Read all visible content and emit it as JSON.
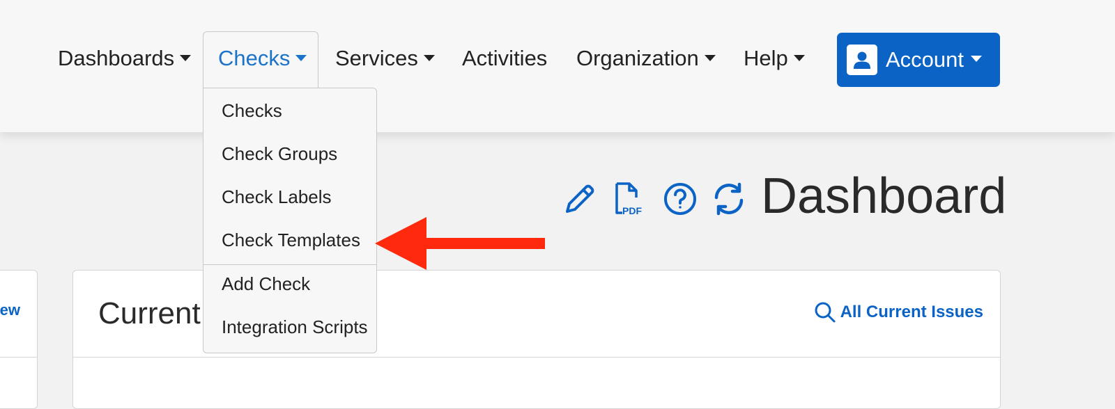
{
  "nav": {
    "dashboards": "Dashboards",
    "checks": "Checks",
    "services": "Services",
    "activities": "Activities",
    "organization": "Organization",
    "help": "Help",
    "account": "Account"
  },
  "checks_menu": {
    "items": [
      "Checks",
      "Check Groups",
      "Check Labels",
      "Check Templates",
      "Add Check",
      "Integration Scripts"
    ]
  },
  "page": {
    "title": "Dashboard",
    "toolbar_icons": [
      "pencil-icon",
      "pdf-icon",
      "help-circle-icon",
      "refresh-icon"
    ]
  },
  "cards": {
    "left_link": "View",
    "main_title": "Current",
    "main_link": "All Current Issues"
  },
  "colors": {
    "accent": "#0b63c6",
    "active_tab": "#1a73c8",
    "arrow": "#ff2a0d"
  }
}
